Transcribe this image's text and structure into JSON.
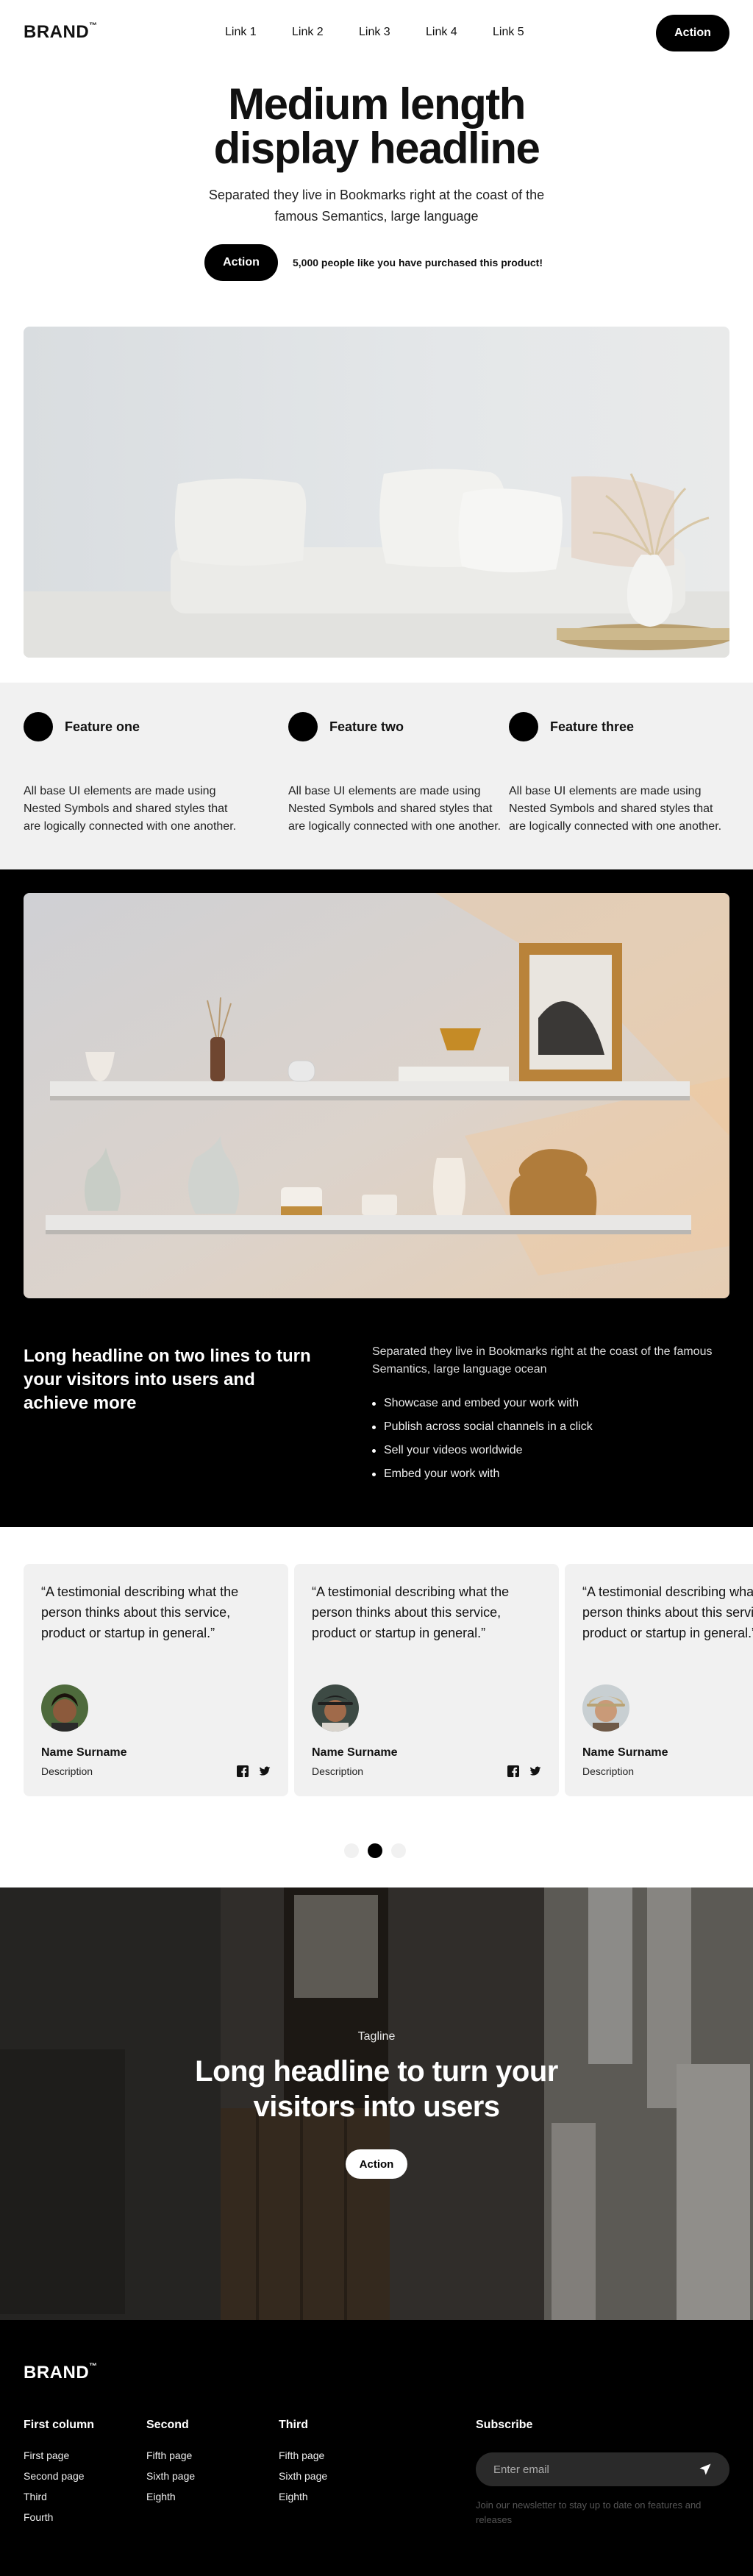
{
  "nav": {
    "brand": "BRAND",
    "brand_mark": "™",
    "links": [
      "Link 1",
      "Link 2",
      "Link 3",
      "Link 4",
      "Link 5"
    ],
    "action": "Action"
  },
  "hero": {
    "headline_line1": "Medium length",
    "headline_line2": "display headline",
    "subtitle": "Separated they live in Bookmarks right at the coast of the famous Semantics, large language",
    "action": "Action",
    "note": "5,000 people like you have purchased this product!"
  },
  "features": [
    {
      "title": "Feature one",
      "body": "All base UI elements are made using Nested Symbols and shared styles that are logically connected with one another."
    },
    {
      "title": "Feature two",
      "body": "All base UI elements are made using Nested Symbols and shared styles that are logically connected with one another."
    },
    {
      "title": "Feature three",
      "body": "All base UI elements are made using Nested Symbols and shared styles that are logically connected with one another."
    }
  ],
  "showcase": {
    "headline": "Long headline on two lines to turn your visitors into users and achieve more",
    "description": "Separated they live in Bookmarks right at the coast of the famous Semantics, large language ocean",
    "bullets": [
      "Showcase and embed your work with",
      "Publish across social channels in a click",
      "Sell your videos worldwide",
      "Embed your work with"
    ]
  },
  "testimonials": [
    {
      "quote": "“A testimonial describing what the person thinks about this service, product or startup in general.”",
      "name": "Name Surname",
      "description": "Description"
    },
    {
      "quote": "“A testimonial describing what the person thinks about this service, product or startup in general.”",
      "name": "Name Surname",
      "description": "Description"
    },
    {
      "quote": "“A testimonial describing what the person thinks about this service, product or startup in general.”",
      "name": "Name Surname",
      "description": "Description"
    }
  ],
  "carousel": {
    "active_index": 1,
    "count": 3
  },
  "banner": {
    "tagline": "Tagline",
    "headline": "Long headline to turn your visitors into users",
    "action": "Action"
  },
  "footer": {
    "brand": "BRAND",
    "brand_mark": "™",
    "columns": [
      {
        "title": "First column",
        "links": [
          "First page",
          "Second page",
          "Third",
          "Fourth"
        ]
      },
      {
        "title": "Second",
        "links": [
          "Fifth page",
          "Sixth page",
          "Eighth"
        ]
      },
      {
        "title": "Third",
        "links": [
          "Fifth page",
          "Sixth page",
          "Eighth"
        ]
      }
    ],
    "subscribe": {
      "title": "Subscribe",
      "placeholder": "Enter email",
      "note": "Join our newsletter to stay up to date on features and releases"
    }
  },
  "colors": {
    "dark": "#000000",
    "light_panel": "#f1f1f1",
    "text": "#111111"
  },
  "icons": [
    "facebook-icon",
    "twitter-icon",
    "send-icon"
  ]
}
